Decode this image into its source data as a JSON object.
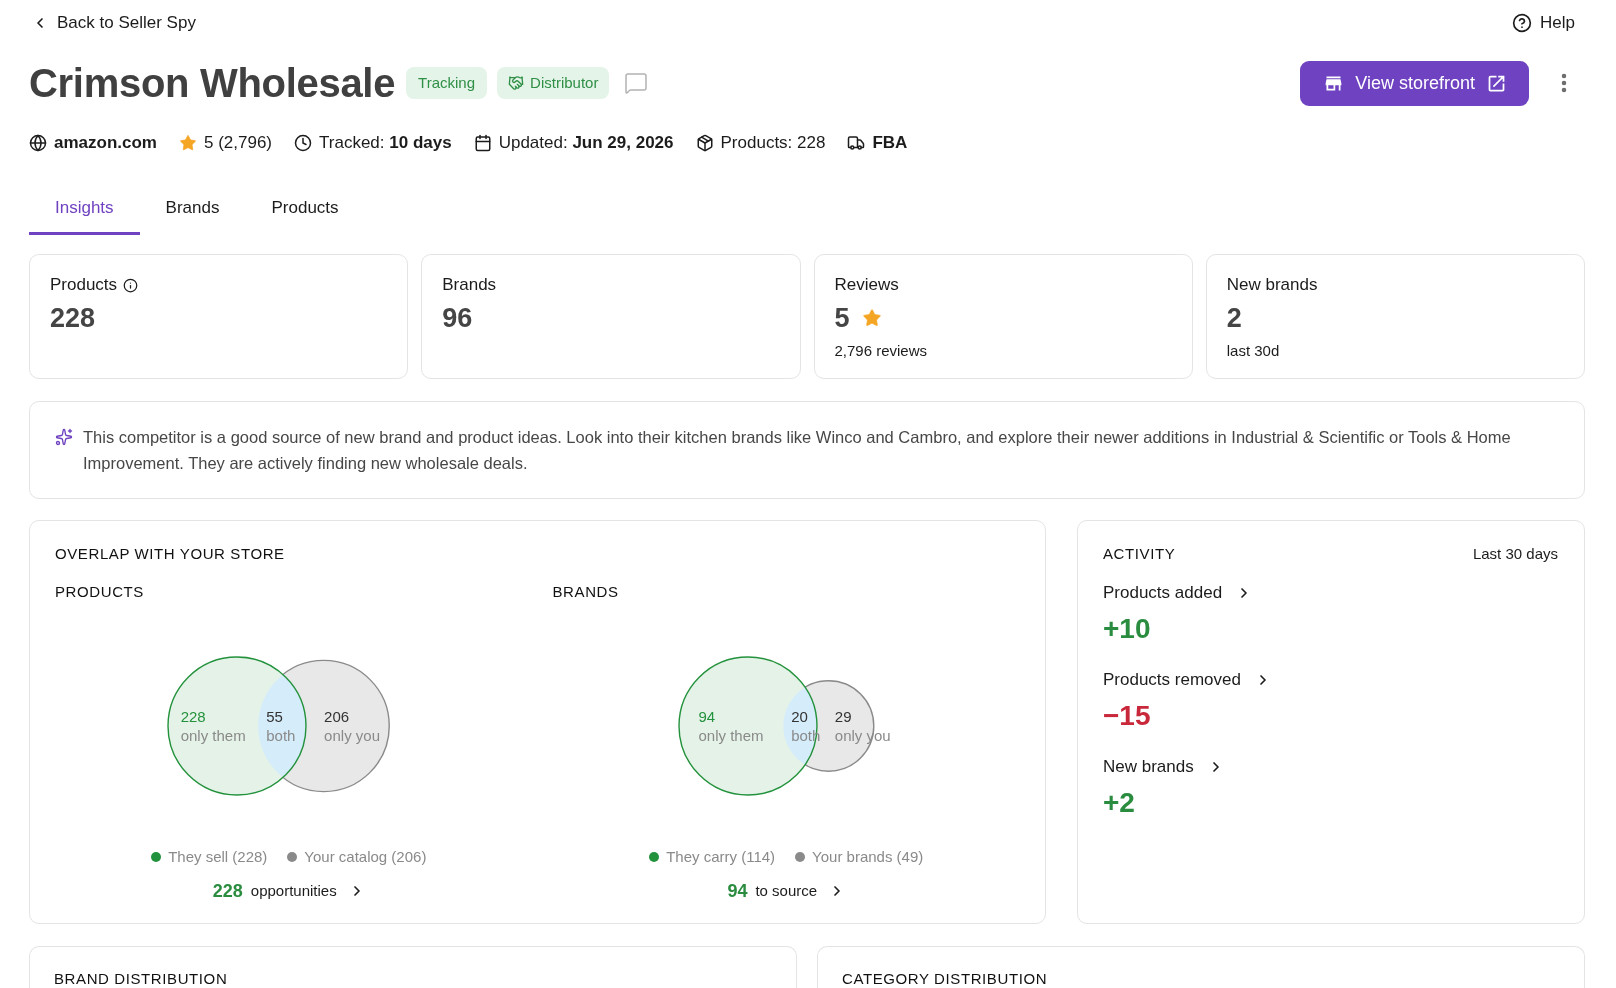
{
  "nav": {
    "back_link": "Back to Seller Spy",
    "help": "Help"
  },
  "header": {
    "title": "Crimson Wholesale",
    "badges": [
      {
        "kind": "status",
        "label": "Tracking"
      },
      {
        "kind": "type",
        "label": "Distributor"
      }
    ],
    "primary_action": "View storefront"
  },
  "meta": [
    {
      "kind": "site",
      "text": "amazon.com"
    },
    {
      "kind": "rating",
      "text": "5 (2,796)"
    },
    {
      "kind": "tracked",
      "text": "Tracked: **10 days**"
    },
    {
      "kind": "updated",
      "text": "Updated: **Jun 29, 2026**"
    },
    {
      "kind": "products",
      "text": "Products: 228"
    },
    {
      "kind": "fulfillment",
      "text": "FBA"
    }
  ],
  "tabs": [
    {
      "label": "Insights",
      "selected": true
    },
    {
      "label": "Brands",
      "selected": false
    },
    {
      "label": "Products",
      "selected": false
    }
  ],
  "stats": [
    {
      "kind": "info",
      "label": "Products",
      "value": "228"
    },
    {
      "kind": "plain",
      "label": "Brands",
      "value": "96"
    },
    {
      "kind": "rating",
      "label": "Reviews",
      "value": "5",
      "note": "2,796 reviews"
    },
    {
      "kind": "plain",
      "label": "New brands",
      "value": "2",
      "note": "last 30d"
    }
  ],
  "insight": {
    "text": "This competitor is a good source of new brand and product ideas. Look into their kitchen brands like Winco and Cambro, and explore their newer additions in Industrial & Scientific or Tools & Home Improvement. They are actively finding new wholesale deals."
  },
  "overlap": {
    "title": "OVERLAP WITH YOUR STORE",
    "panels": [
      {
        "title": "PRODUCTS",
        "regions": [
          {
            "kind": "only_them",
            "value": "228",
            "label": "only them"
          },
          {
            "kind": "both",
            "value": "55",
            "label": "both"
          },
          {
            "kind": "only_you",
            "value": "206",
            "label": "only you"
          }
        ],
        "legend": [
          {
            "label": "They sell (228)",
            "color": "#23923c"
          },
          {
            "label": "Your catalog (206)",
            "color": "#8a8a8a"
          }
        ],
        "link": {
          "count": "228",
          "label": "opportunities"
        }
      },
      {
        "title": "BRANDS",
        "regions": [
          {
            "kind": "only_them",
            "value": "94",
            "label": "only them"
          },
          {
            "kind": "both",
            "value": "20",
            "label": "both"
          },
          {
            "kind": "only_you",
            "value": "29",
            "label": "only you"
          }
        ],
        "legend": [
          {
            "label": "They carry (114)",
            "color": "#23923c"
          },
          {
            "label": "Your brands (49)",
            "color": "#8a8a8a"
          }
        ],
        "link": {
          "count": "94",
          "label": "to source"
        }
      }
    ]
  },
  "activity": {
    "title": "ACTIVITY",
    "period": "Last 30 days",
    "items": [
      {
        "kind": "increase",
        "label": "Products added",
        "value": "+10"
      },
      {
        "kind": "decrease",
        "label": "Products removed",
        "value": "−15"
      },
      {
        "kind": "increase",
        "label": "New brands",
        "value": "+2"
      }
    ]
  },
  "sections": [
    {
      "title": "BRAND DISTRIBUTION"
    },
    {
      "title": "CATEGORY DISTRIBUTION"
    }
  ]
}
